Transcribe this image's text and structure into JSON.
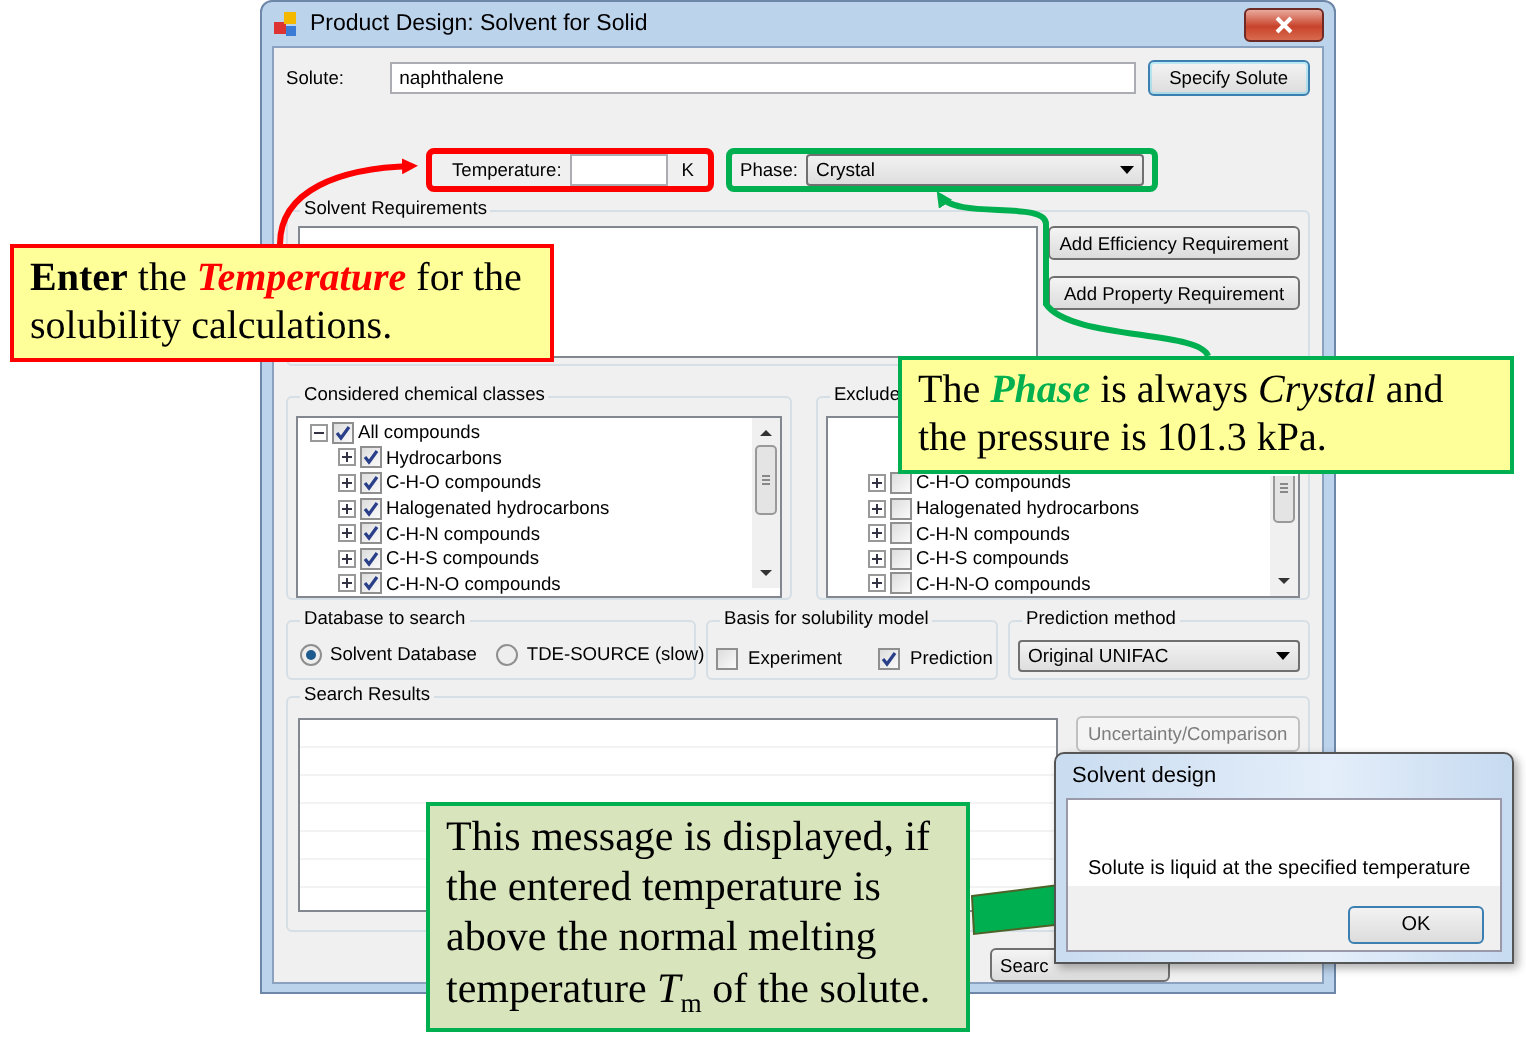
{
  "window": {
    "title": "Product Design: Solvent for Solid"
  },
  "solute": {
    "label": "Solute:",
    "value": "naphthalene",
    "button": "Specify Solute"
  },
  "temperature": {
    "label": "Temperature:",
    "unit": "K"
  },
  "phase": {
    "label": "Phase:",
    "value": "Crystal"
  },
  "solvent_requirements": {
    "title": "Solvent Requirements",
    "buttons": [
      "Add Efficiency Requirement",
      "Add Property Requirement"
    ]
  },
  "considered_classes": {
    "title": "Considered chemical classes",
    "tree": [
      {
        "label": "All compounds",
        "checked": true,
        "expanded": true,
        "children": [
          {
            "label": "Hydrocarbons",
            "checked": true,
            "expanded": false
          },
          {
            "label": "C-H-O compounds",
            "checked": true,
            "expanded": false
          },
          {
            "label": "Halogenated hydrocarbons",
            "checked": true,
            "expanded": false
          },
          {
            "label": "C-H-N compounds",
            "checked": true,
            "expanded": false
          },
          {
            "label": "C-H-S compounds",
            "checked": true,
            "expanded": false
          },
          {
            "label": "C-H-N-O compounds",
            "checked": true,
            "expanded": false
          }
        ]
      }
    ]
  },
  "excluded_classes": {
    "title": "Exclude",
    "items": [
      {
        "label": "C-H-O compounds",
        "checked": false,
        "expanded": false
      },
      {
        "label": "Halogenated hydrocarbons",
        "checked": false,
        "expanded": false
      },
      {
        "label": "C-H-N compounds",
        "checked": false,
        "expanded": false
      },
      {
        "label": "C-H-S compounds",
        "checked": false,
        "expanded": false
      },
      {
        "label": "C-H-N-O compounds",
        "checked": false,
        "expanded": false
      }
    ]
  },
  "database": {
    "title": "Database to search",
    "options": [
      {
        "label": "Solvent Database",
        "selected": true
      },
      {
        "label": "TDE-SOURCE (slow)",
        "selected": false
      }
    ]
  },
  "basis": {
    "title": "Basis for solubility model",
    "options": [
      {
        "label": "Experiment",
        "checked": false
      },
      {
        "label": "Prediction",
        "checked": true
      }
    ]
  },
  "prediction": {
    "title": "Prediction method",
    "value": "Original UNIFAC"
  },
  "search_results": {
    "title": "Search Results",
    "button": {
      "label": "Uncertainty/Comparison",
      "disabled": true
    }
  },
  "bottom_buttons": [
    {
      "label": "Searc"
    }
  ],
  "dialog": {
    "title": "Solvent design",
    "message": "Solute is liquid at the specified temperature",
    "button": "OK"
  },
  "callouts": [
    {
      "kind": "hint",
      "color": "#ff0000",
      "text": "**Enter** the *Temperature* for the solubility calculations."
    },
    {
      "kind": "note",
      "color": "#00b050",
      "text": "The **Phase** is always *Crystal* and the pressure is 101.3 kPa."
    },
    {
      "kind": "info",
      "color": "#00b050",
      "text": "This message is displayed, if the entered temperature is above the normal melting temperature *T*$_{m}$ of the solute."
    }
  ]
}
